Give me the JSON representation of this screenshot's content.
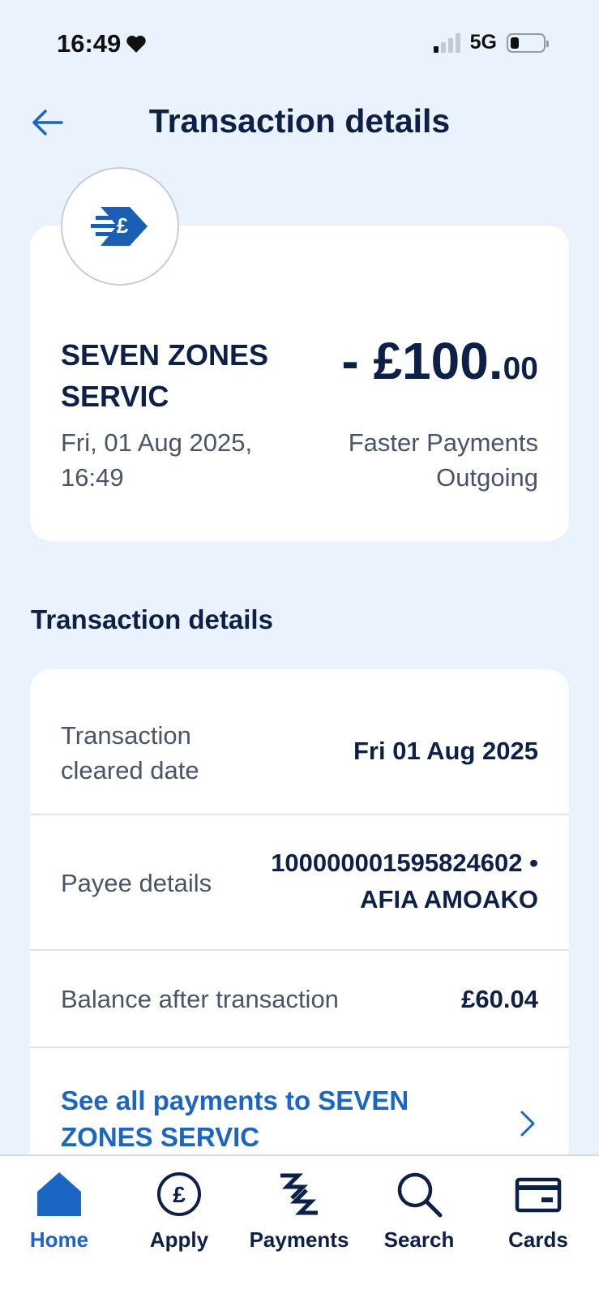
{
  "status_bar": {
    "time": "16:49",
    "network": "5G"
  },
  "header": {
    "title": "Transaction details"
  },
  "summary": {
    "merchant": "SEVEN ZONES SERVIC",
    "date": "Fri, 01 Aug 2025, 16:49",
    "amount_main": "- £100.",
    "amount_pence": "00",
    "payment_type": "Faster Payments Outgoing"
  },
  "details": {
    "section_title": "Transaction details",
    "rows": [
      {
        "label": "Transaction cleared date",
        "value": "Fri 01 Aug 2025"
      },
      {
        "label": "Payee details",
        "value": "100000001595824602 • AFIA AMOAKO"
      },
      {
        "label": "Balance after transaction",
        "value": "£60.04"
      }
    ],
    "link_text": "See all payments to SEVEN ZONES SERVIC"
  },
  "bottom_nav": {
    "items": [
      {
        "label": "Home",
        "icon": "home-icon",
        "active": true
      },
      {
        "label": "Apply",
        "icon": "pound-circle-icon",
        "active": false
      },
      {
        "label": "Payments",
        "icon": "payments-arrows-icon",
        "active": false
      },
      {
        "label": "Search",
        "icon": "search-icon",
        "active": false
      },
      {
        "label": "Cards",
        "icon": "card-icon",
        "active": false
      }
    ]
  },
  "colors": {
    "background": "#eaf3fd",
    "primary_navy": "#0d2047",
    "accent_blue": "#1a66c2",
    "secondary_text": "#4a5468"
  }
}
